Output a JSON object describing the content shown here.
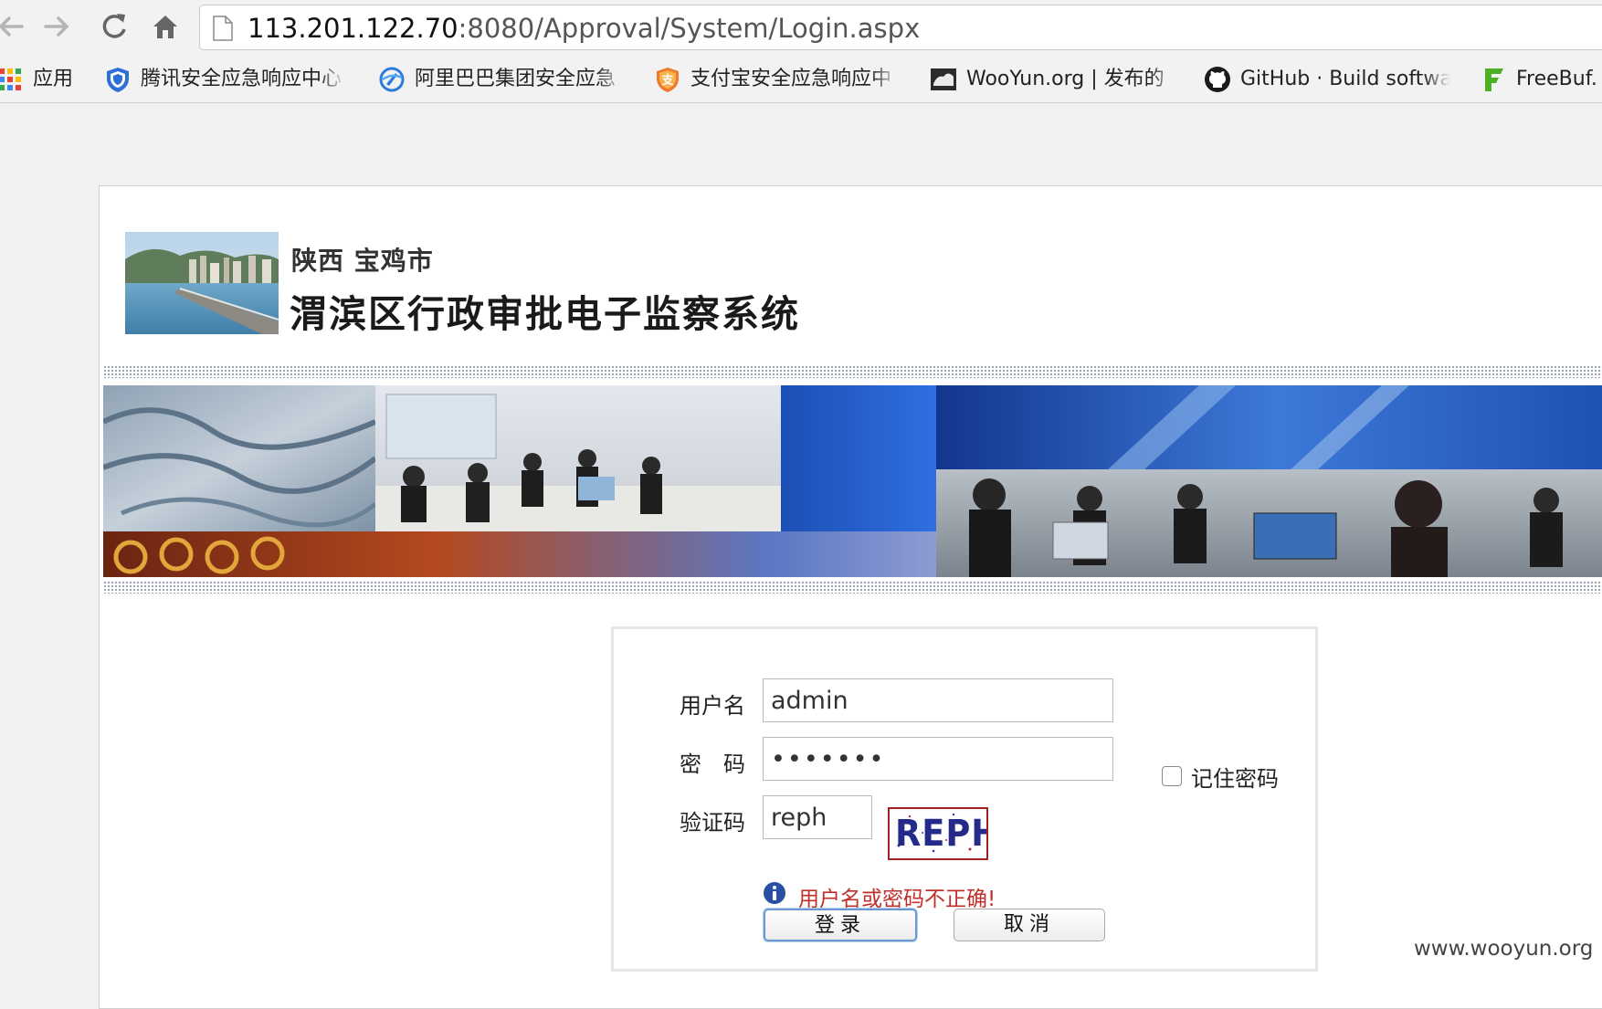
{
  "browser": {
    "url_host": "113.201.122.70",
    "url_path": ":8080/Approval/System/Login.aspx",
    "bookmarks": [
      {
        "label": "应用",
        "icon": "apps-grid-icon"
      },
      {
        "label": "腾讯安全应急响应中心",
        "icon": "tsrc-shield-icon"
      },
      {
        "label": "阿里巴巴集团安全应急",
        "icon": "alibaba-security-icon"
      },
      {
        "label": "支付宝安全应急响应中",
        "icon": "alipay-shield-icon"
      },
      {
        "label": "WooYun.org | 发布的",
        "icon": "wooyun-icon"
      },
      {
        "label": "GitHub · Build softwa",
        "icon": "github-icon"
      },
      {
        "label": "FreeBuf.",
        "icon": "freebuf-icon"
      }
    ]
  },
  "header": {
    "province": "陕西 宝鸡市",
    "title": "渭滨区行政审批电子监察系统"
  },
  "login": {
    "username_label": "用户名",
    "username_value": "admin",
    "password_label": "密　码",
    "password_value": "•••••••",
    "remember_label": "记住密码",
    "captcha_label": "验证码",
    "captcha_value": "reph",
    "captcha_image_text": "REPH",
    "error_message": "用户名或密码不正确!",
    "login_button": "登录",
    "cancel_button": "取消"
  },
  "watermark": "www.wooyun.org",
  "colors": {
    "error": "#c0302b",
    "captcha_border": "#a02222",
    "captcha_text": "#242a8a",
    "focus_ring": "#6a98d2"
  }
}
